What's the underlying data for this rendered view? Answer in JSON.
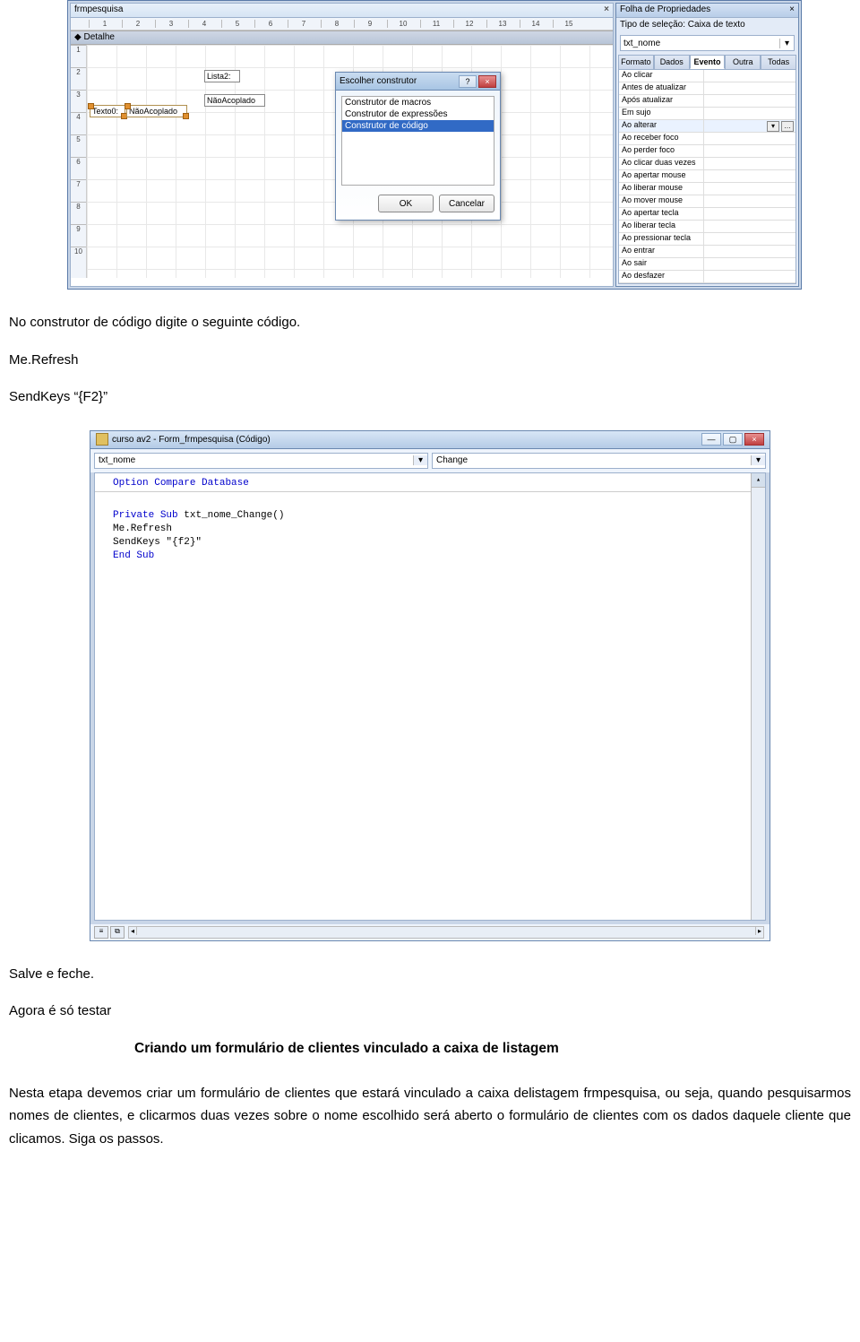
{
  "shot1": {
    "form_tab": "frmpesquisa",
    "section": "Detalhe",
    "ruler_h": [
      "1",
      "2",
      "3",
      "4",
      "5",
      "6",
      "7",
      "8",
      "9",
      "10",
      "11",
      "12",
      "13",
      "14",
      "15"
    ],
    "ruler_v": [
      "1",
      "2",
      "3",
      "4",
      "5",
      "6",
      "7",
      "8",
      "9",
      "10"
    ],
    "ctrl_text_label": "Texto0:",
    "ctrl_text_val": "NãoAcoplado",
    "ctrl_list_label": "Lista2:",
    "ctrl_list_val": "NãoAcoplado",
    "builder_title": "Escolher construtor",
    "builder_items": [
      "Construtor de macros",
      "Construtor de expressões",
      "Construtor de código"
    ],
    "builder_selected_idx": 2,
    "btn_ok": "OK",
    "btn_cancel": "Cancelar",
    "prop_title": "Folha de Propriedades",
    "prop_seltype": "Tipo de seleção:  Caixa de texto",
    "prop_obj": "txt_nome",
    "prop_tabs": [
      "Formato",
      "Dados",
      "Evento",
      "Outra",
      "Todas"
    ],
    "prop_tab_active_idx": 2,
    "prop_events": [
      "Ao clicar",
      "Antes de atualizar",
      "Após atualizar",
      "Em sujo",
      "Ao alterar",
      "Ao receber foco",
      "Ao perder foco",
      "Ao clicar duas vezes",
      "Ao apertar mouse",
      "Ao liberar mouse",
      "Ao mover mouse",
      "Ao apertar tecla",
      "Ao liberar tecla",
      "Ao pressionar tecla",
      "Ao entrar",
      "Ao sair",
      "Ao desfazer"
    ],
    "prop_event_selected": "Ao alterar"
  },
  "text1": {
    "p1": "No construtor de código digite o seguinte código.",
    "p2": "Me.Refresh",
    "p3": "SendKeys “{F2}”"
  },
  "shot2": {
    "title": "curso av2 - Form_frmpesquisa (Código)",
    "combo_obj": "txt_nome",
    "combo_proc": "Change",
    "code_lines": [
      {
        "t": "Option Compare Database",
        "kw": [
          "Option",
          "Compare",
          "Database"
        ]
      },
      {
        "t": ""
      },
      {
        "t": "Private Sub txt_nome_Change()",
        "kw": [
          "Private",
          "Sub"
        ]
      },
      {
        "t": "Me.Refresh",
        "kw": []
      },
      {
        "t": "SendKeys \"{f2}\"",
        "kw": []
      },
      {
        "t": "End Sub",
        "kw": [
          "End",
          "Sub"
        ]
      }
    ]
  },
  "text2": {
    "p1": "Salve e feche.",
    "p2": "Agora é só testar",
    "h": "Criando um formulário de clientes vinculado a caixa de listagem",
    "p3": "Nesta etapa devemos criar um formulário de clientes que estará vinculado a caixa delistagem frmpesquisa, ou seja, quando pesquisarmos nomes de clientes, e clicarmos duas vezes sobre o nome escolhido será aberto o formulário de clientes com os dados daquele cliente que clicamos. Siga os passos."
  }
}
